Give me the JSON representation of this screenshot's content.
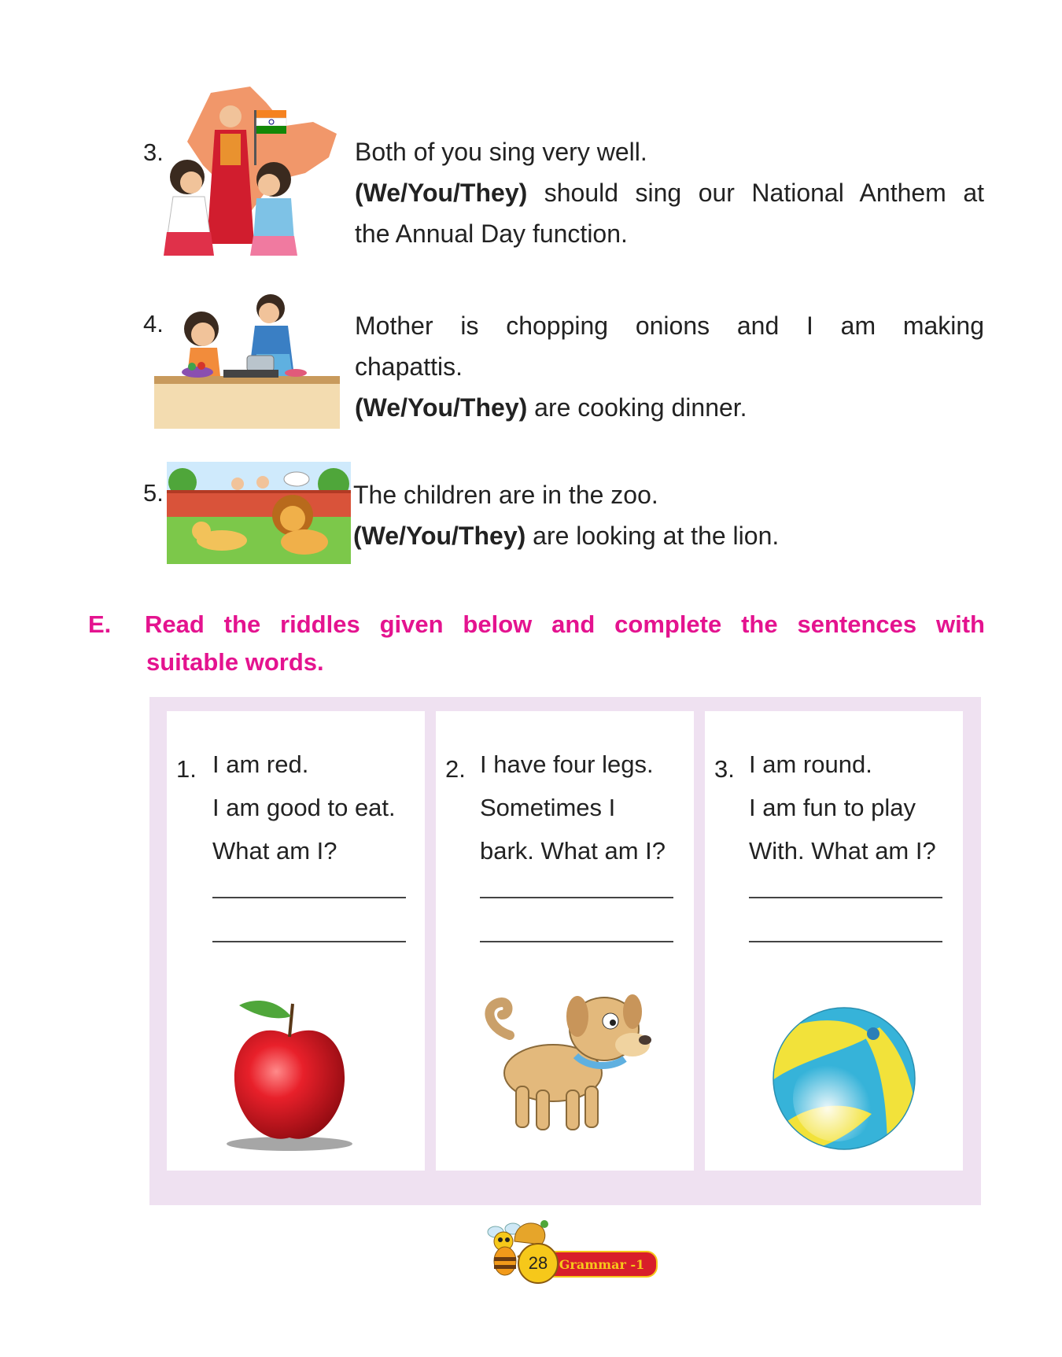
{
  "exercise_items": [
    {
      "number": "3.",
      "sentence": "Both of you sing very well.",
      "choice": "(We/You/They)",
      "rest_line1": " should sing our National Anthem at",
      "rest_line2": "the Annual Day function."
    },
    {
      "number": "4.",
      "sentence_line1": "Mother is chopping onions and I am making",
      "sentence_line2": "chapattis.",
      "choice": "(We/You/They)",
      "rest": " are cooking dinner."
    },
    {
      "number": "5.",
      "sentence": "The children are in the zoo.",
      "choice": "(We/You/They)",
      "rest": " are looking at the lion."
    }
  ],
  "section_e": {
    "letter": "E.",
    "instruction_line1": "Read the riddles given below and complete the sentences with",
    "instruction_line2": "suitable words."
  },
  "riddles": [
    {
      "number": "1.",
      "lines": [
        "I am red.",
        "I am good to eat.",
        "What am I?"
      ],
      "picture": "apple-illustration"
    },
    {
      "number": "2.",
      "lines": [
        "I have four legs.",
        "Sometimes I",
        "bark. What am I?"
      ],
      "picture": "dog-illustration"
    },
    {
      "number": "3.",
      "lines": [
        "I am round.",
        "I am fun to play",
        "With. What am I?"
      ],
      "picture": "ball-illustration"
    }
  ],
  "footer": {
    "page_number": "28",
    "book_label": "Grammar -1"
  },
  "colors": {
    "heading_pink": "#e4138f",
    "frame_lilac": "#efe1f1",
    "badge_red": "#d81e2a",
    "badge_yellow": "#f6c81a"
  }
}
